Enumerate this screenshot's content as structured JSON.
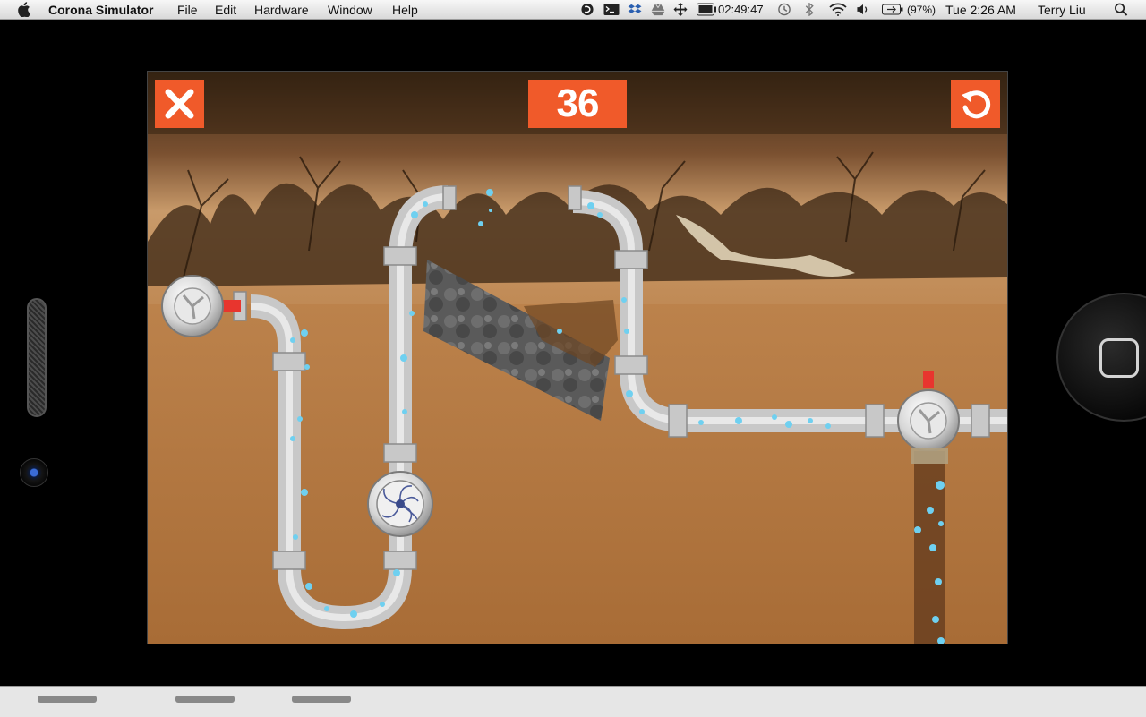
{
  "menubar": {
    "app_name": "Corona Simulator",
    "menus": [
      "File",
      "Edit",
      "Hardware",
      "Window",
      "Help"
    ],
    "timer": "02:49:47",
    "battery": "(97%)",
    "clock": "Tue 2:26 AM",
    "user": "Terry Liu",
    "icons": [
      "apple-icon",
      "skype-icon",
      "terminal-icon",
      "dropbox-icon",
      "drive-icon",
      "move-icon",
      "battery-meter-icon",
      "time-machine-icon",
      "bluetooth-icon",
      "wifi-icon",
      "volume-icon",
      "battery-icon",
      "spotlight-icon"
    ]
  },
  "game": {
    "score": "36",
    "buttons": {
      "close": "close-x-icon",
      "restart": "restart-icon"
    },
    "colors": {
      "hud": "#f05a2a",
      "water": "#6fd0f0",
      "soil": "#b07a45",
      "valve_red": "#e8352e"
    }
  }
}
